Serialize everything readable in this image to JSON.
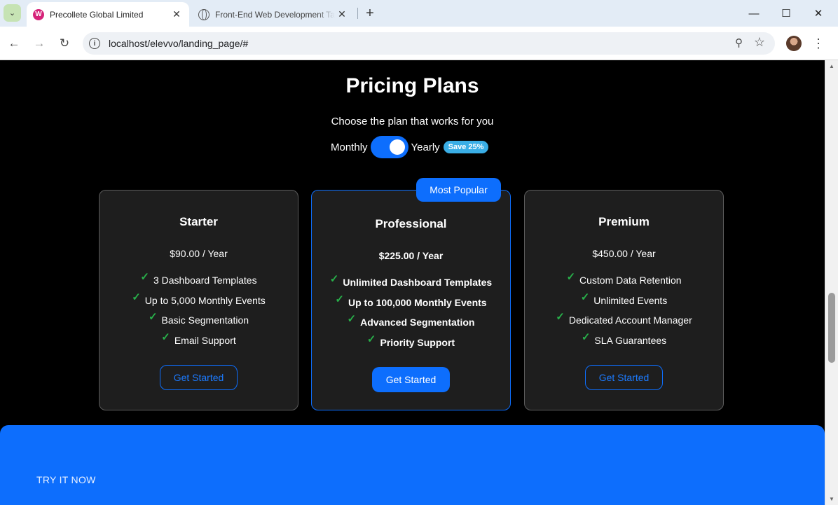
{
  "browser": {
    "active_tab": {
      "title": "Precollete Global Limited",
      "favicon": "W"
    },
    "inactive_tab": {
      "title": "Front-End Web Development Tasks"
    },
    "tab_close": "✕",
    "new_tab": "+",
    "window_controls": {
      "minimize": "—",
      "maximize": "☐",
      "close": "✕"
    },
    "url": "localhost/elevvo/landing_page/#",
    "icons": [
      "back-icon",
      "forward-icon",
      "reload-icon",
      "site-info-icon",
      "zoom-icon",
      "bookmark-star-icon",
      "profile-avatar",
      "more-menu-icon"
    ]
  },
  "pricing": {
    "title": "Pricing Plans",
    "subtitle": "Choose the plan that works for you",
    "toggle": {
      "left_label": "Monthly",
      "right_label": "Yearly",
      "selected": "Yearly",
      "badge": "Save 25%"
    },
    "popular_badge": "Most Popular",
    "plans": [
      {
        "name": "Starter",
        "price": "$90.00 / Year",
        "features": [
          "3 Dashboard Templates",
          "Up to 5,000 Monthly Events",
          "Basic Segmentation",
          "Email Support"
        ],
        "cta": "Get Started"
      },
      {
        "name": "Professional",
        "price": "$225.00 / Year",
        "features": [
          "Unlimited Dashboard Templates",
          "Up to 100,000 Monthly Events",
          "Advanced Segmentation",
          "Priority Support"
        ],
        "cta": "Get Started"
      },
      {
        "name": "Premium",
        "price": "$450.00 / Year",
        "features": [
          "Custom Data Retention",
          "Unlimited Events",
          "Dedicated Account Manager",
          "SLA Guarantees"
        ],
        "cta": "Get Started"
      }
    ]
  },
  "cta_section": {
    "label": "TRY IT NOW"
  },
  "colors": {
    "accent": "#0d6efd",
    "badge": "#3aaee6",
    "check": "#28b04a",
    "card_bg": "#1e1e1e",
    "page_bg": "#000000"
  }
}
